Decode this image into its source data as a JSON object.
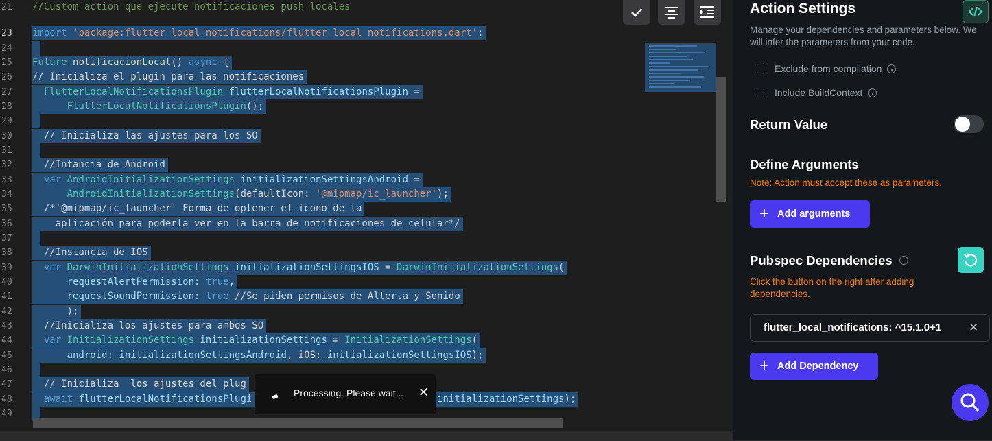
{
  "editor": {
    "lines": [
      {
        "n": "21",
        "segs": [
          [
            "//Custom action que ejecute notificaciones push locales",
            "cmt"
          ]
        ],
        "sel": false
      },
      {
        "n": "23",
        "segs": [
          [
            "import ",
            "kw"
          ],
          [
            "'package:flutter_local_notifications/flutter_local_notifications.dart'",
            "str"
          ],
          [
            ";",
            ""
          ]
        ],
        "sel": true,
        "active": true
      },
      {
        "n": "24",
        "segs": [
          [
            " ",
            ""
          ]
        ],
        "sel": true
      },
      {
        "n": "25",
        "segs": [
          [
            "Future ",
            "cls"
          ],
          [
            "notificacionLocal",
            "fn"
          ],
          [
            "() ",
            ""
          ],
          [
            "async",
            "kw"
          ],
          [
            " {",
            ""
          ]
        ],
        "sel": true
      },
      {
        "n": "26",
        "segs": [
          [
            "// Inicializa el plugin para las notificaciones",
            "cmt"
          ]
        ],
        "sel": true
      },
      {
        "n": "27",
        "segs": [
          [
            "  FlutterLocalNotificationsPlugin ",
            "cls"
          ],
          [
            "flutterLocalNotificationsPlugin",
            "var"
          ],
          [
            " =",
            ""
          ]
        ],
        "sel": true
      },
      {
        "n": "28",
        "segs": [
          [
            "      FlutterLocalNotificationsPlugin",
            "cls"
          ],
          [
            "();",
            ""
          ]
        ],
        "sel": true
      },
      {
        "n": "29",
        "segs": [
          [
            " ",
            ""
          ]
        ],
        "sel": true
      },
      {
        "n": "30",
        "segs": [
          [
            "  // Inicializa las ajustes para los SO",
            "cmt"
          ]
        ],
        "sel": true
      },
      {
        "n": "31",
        "segs": [
          [
            " ",
            ""
          ]
        ],
        "sel": true
      },
      {
        "n": "32",
        "segs": [
          [
            "  //Intancia de Android",
            "cmt"
          ]
        ],
        "sel": true
      },
      {
        "n": "33",
        "segs": [
          [
            "  var ",
            "kw"
          ],
          [
            "AndroidInitializationSettings ",
            "cls"
          ],
          [
            "initializationSettingsAndroid",
            "var"
          ],
          [
            " =",
            ""
          ]
        ],
        "sel": true
      },
      {
        "n": "34",
        "segs": [
          [
            "      AndroidInitializationSettings",
            "cls"
          ],
          [
            "(defaultIcon: ",
            ""
          ],
          [
            "'@mipmap/ic_launcher'",
            "str"
          ],
          [
            ");",
            ""
          ]
        ],
        "sel": true
      },
      {
        "n": "35",
        "segs": [
          [
            "  /*'@mipmap/ic_launcher' Forma de optener el icono de la",
            "cmt"
          ]
        ],
        "sel": true
      },
      {
        "n": "36",
        "segs": [
          [
            "    aplicación para poderla ver en la barra de notificaciones de celular*/",
            "cmt"
          ]
        ],
        "sel": true
      },
      {
        "n": "37",
        "segs": [
          [
            " ",
            ""
          ]
        ],
        "sel": true
      },
      {
        "n": "38",
        "segs": [
          [
            "  //Instancia de IOS",
            "cmt"
          ]
        ],
        "sel": true
      },
      {
        "n": "39",
        "segs": [
          [
            "  var ",
            "kw"
          ],
          [
            "DarwinInitializationSettings ",
            "cls"
          ],
          [
            "initializationSettingsIOS",
            "var"
          ],
          [
            " = ",
            ""
          ],
          [
            "DarwinInitializationSettings",
            "cls"
          ],
          [
            "(",
            ""
          ]
        ],
        "sel": true
      },
      {
        "n": "40",
        "segs": [
          [
            "      requestAlertPermission: ",
            "var"
          ],
          [
            "true",
            "kw"
          ],
          [
            ",",
            ""
          ]
        ],
        "sel": true
      },
      {
        "n": "41",
        "segs": [
          [
            "      requestSoundPermission: ",
            "var"
          ],
          [
            "true ",
            "kw"
          ],
          [
            "//Se piden permisos de Alterta y Sonido",
            "cmt"
          ]
        ],
        "sel": true
      },
      {
        "n": "42",
        "segs": [
          [
            "      );",
            ""
          ]
        ],
        "sel": true
      },
      {
        "n": "43",
        "segs": [
          [
            "  //Inicializa los ajustes para ambos SO",
            "cmt"
          ]
        ],
        "sel": true
      },
      {
        "n": "44",
        "segs": [
          [
            "  var ",
            "kw"
          ],
          [
            "InitializationSettings ",
            "cls"
          ],
          [
            "initializationSettings",
            "var"
          ],
          [
            " = ",
            ""
          ],
          [
            "InitializationSettings",
            "cls"
          ],
          [
            "(",
            ""
          ]
        ],
        "sel": true
      },
      {
        "n": "45",
        "segs": [
          [
            "      android: ",
            "var"
          ],
          [
            "initializationSettingsAndroid",
            "var"
          ],
          [
            ", iOS: ",
            ""
          ],
          [
            "initializationSettingsIOS",
            "var"
          ],
          [
            ");",
            ""
          ]
        ],
        "sel": true
      },
      {
        "n": "46",
        "segs": [
          [
            " ",
            ""
          ]
        ],
        "sel": true
      },
      {
        "n": "47",
        "segs": [
          [
            "  // Inicializa  los ajustes del plug",
            "cmt"
          ]
        ],
        "sel": true
      },
      {
        "n": "48",
        "segs": [
          [
            "  await ",
            "kw"
          ],
          [
            "flutterLocalNotificationsPlugi",
            "var"
          ],
          [
            "                         tings: ",
            ""
          ],
          [
            "initializationSettings",
            "var"
          ],
          [
            ");",
            ""
          ]
        ],
        "sel": true
      },
      {
        "n": "49",
        "segs": [
          [
            " ",
            ""
          ]
        ],
        "sel": true
      }
    ],
    "toolbar": [
      "check-icon",
      "format-align-center-icon",
      "indent-icon"
    ]
  },
  "toast": {
    "text": "Processing. Please wait...",
    "close": "✕"
  },
  "panel": {
    "title": "Action Settings",
    "description": "Manage your dependencies and parameters below. We will infer the parameters from your code.",
    "checkboxes": [
      {
        "label": "Exclude from compilation",
        "checked": false
      },
      {
        "label": "Include BuildContext",
        "checked": false
      }
    ],
    "return_value": {
      "label": "Return Value",
      "on": false
    },
    "arguments": {
      "title": "Define Arguments",
      "note": "Note: Action must accept these as parameters.",
      "button": "Add arguments"
    },
    "pubspec": {
      "title": "Pubspec Dependencies",
      "note": "Click the button on the right after adding dependencies.",
      "dependency": "flutter_local_notifications: ^15.1.0+1",
      "button": "Add Dependency"
    }
  },
  "colors": {
    "accent": "#4b39ef",
    "teal": "#39d2c0",
    "warning": "#f07c1a",
    "selection": "#264f78"
  }
}
